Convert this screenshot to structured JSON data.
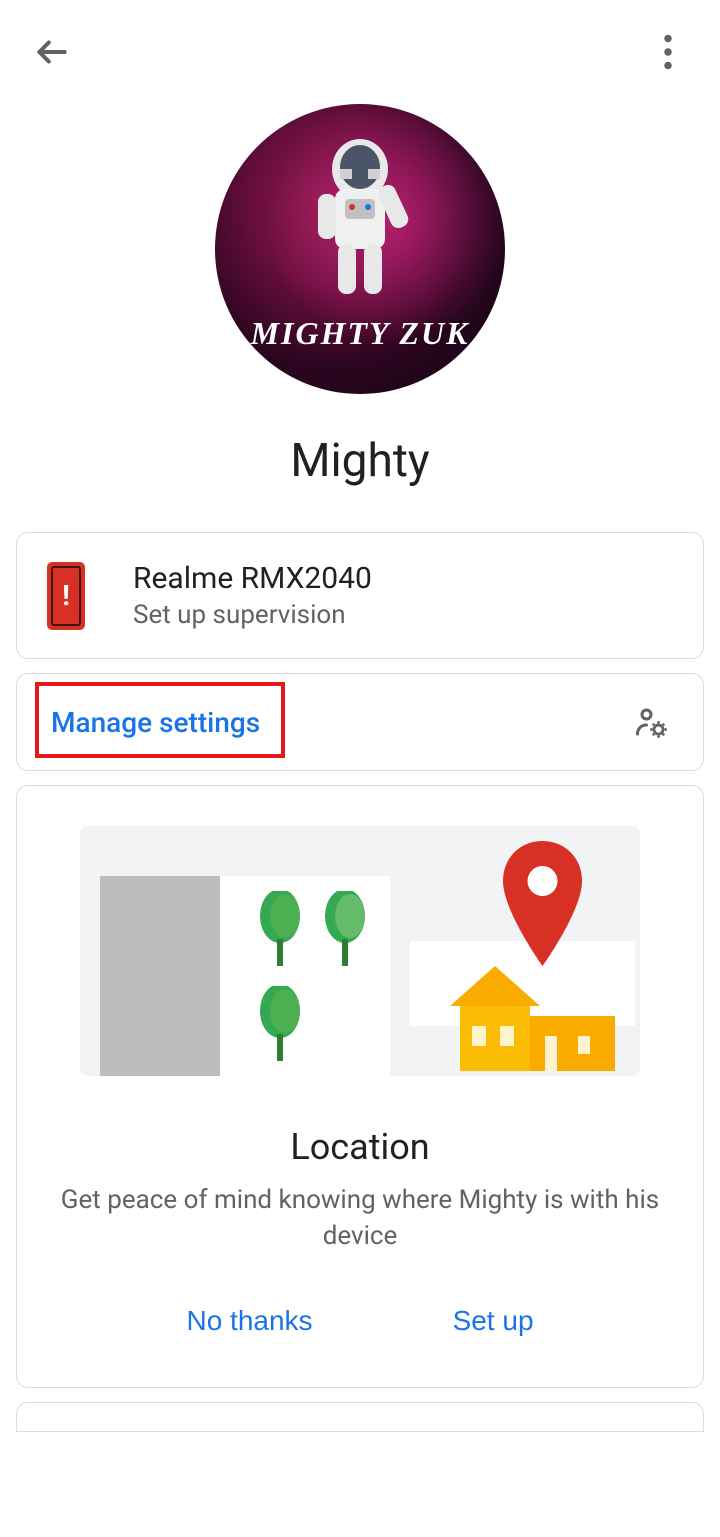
{
  "profile": {
    "name": "Mighty",
    "avatar_text": "MIGHTY ZUK"
  },
  "device": {
    "name": "Realme RMX2040",
    "subtitle": "Set up supervision"
  },
  "manage": {
    "label": "Manage settings"
  },
  "location": {
    "title": "Location",
    "description": "Get peace of mind knowing where Mighty is with his device",
    "no_thanks": "No thanks",
    "set_up": "Set up"
  }
}
